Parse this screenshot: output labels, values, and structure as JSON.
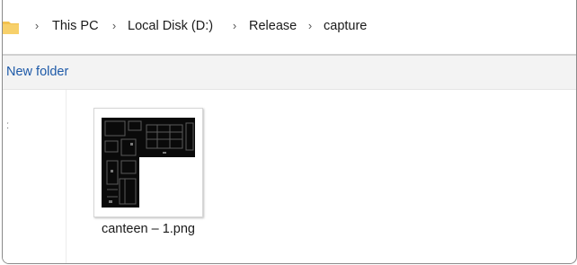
{
  "breadcrumb": {
    "items": [
      "This PC",
      "Local Disk (D:)",
      "Release",
      "capture"
    ],
    "separator": "›"
  },
  "toolbar": {
    "new_folder_label": "New folder"
  },
  "files": [
    {
      "name": "canteen – 1.png",
      "icon": "image-thumbnail"
    }
  ],
  "colors": {
    "accent": "#1e5aa8",
    "folder": "#f2c14e",
    "toolbar_bg": "#f3f3f3"
  }
}
